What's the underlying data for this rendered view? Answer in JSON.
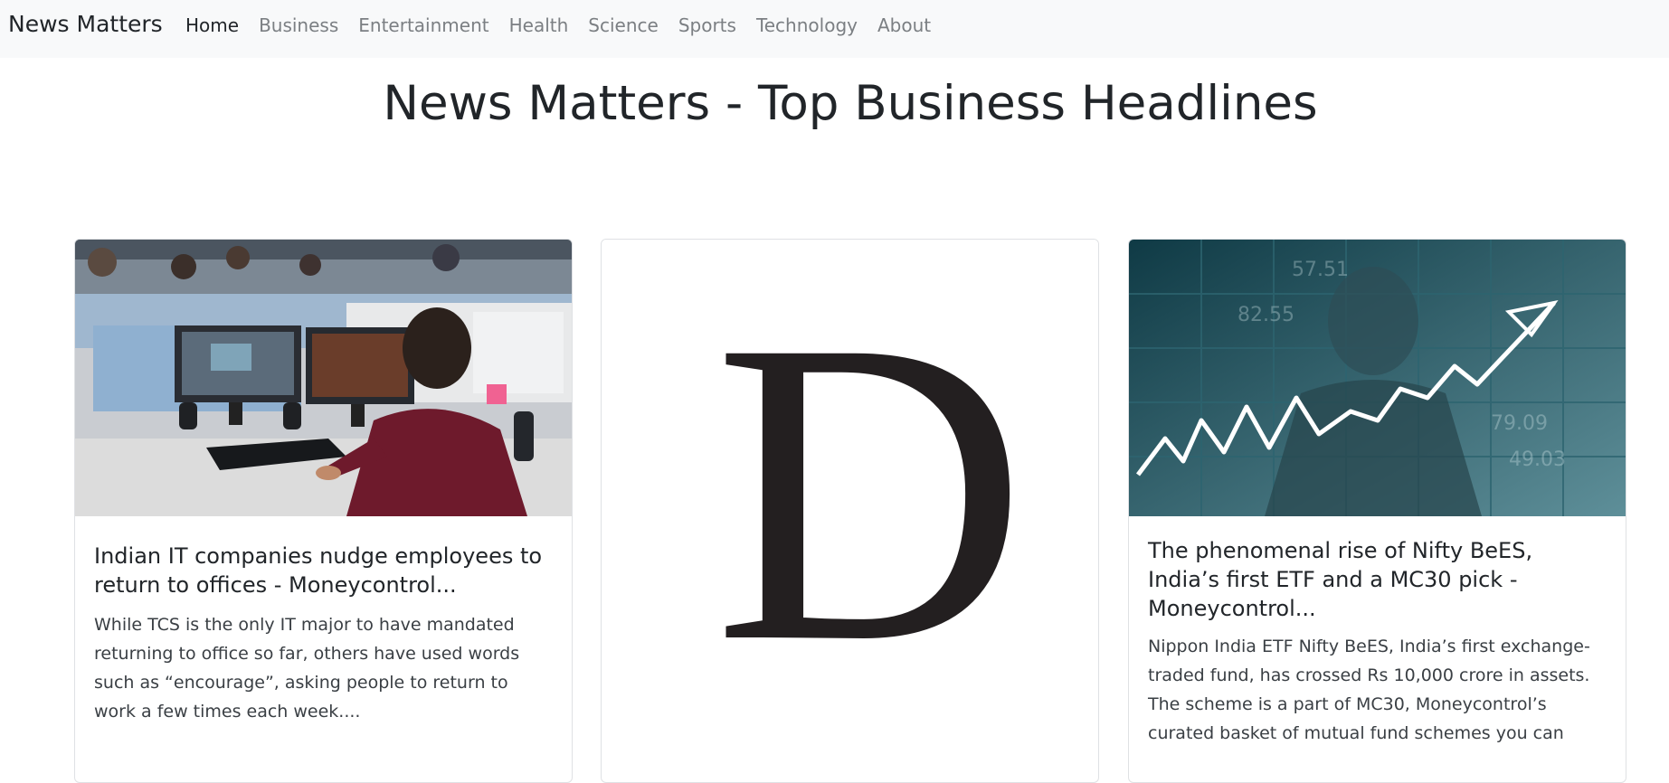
{
  "nav": {
    "brand": "News Matters",
    "items": [
      {
        "label": "Home"
      },
      {
        "label": "Business"
      },
      {
        "label": "Entertainment"
      },
      {
        "label": "Health"
      },
      {
        "label": "Science"
      },
      {
        "label": "Sports"
      },
      {
        "label": "Technology"
      },
      {
        "label": "About"
      }
    ]
  },
  "page": {
    "title": "News Matters - Top Business Headlines"
  },
  "cards": [
    {
      "image": "office-workers-photo",
      "title": "Indian IT companies nudge employees to return to offices - Moneycontrol...",
      "text": "While TCS is the only IT major to have mandated returning to office so far, others have used words such as “encourage”, asking people to return to work a few times each week...."
    },
    {
      "image": "publisher-logo-D",
      "logo_letter": "D",
      "title": "",
      "text": ""
    },
    {
      "image": "stock-market-photo",
      "title": "The phenomenal rise of Nifty BeES, India’s first ETF and a MC30 pick - Moneycontrol...",
      "text": "Nippon India ETF Nifty BeES, India’s first exchange-traded fund, has crossed Rs 10,000 crore in assets. The scheme is a part of MC30, Moneycontrol’s curated basket of mutual fund schemes you can"
    }
  ]
}
